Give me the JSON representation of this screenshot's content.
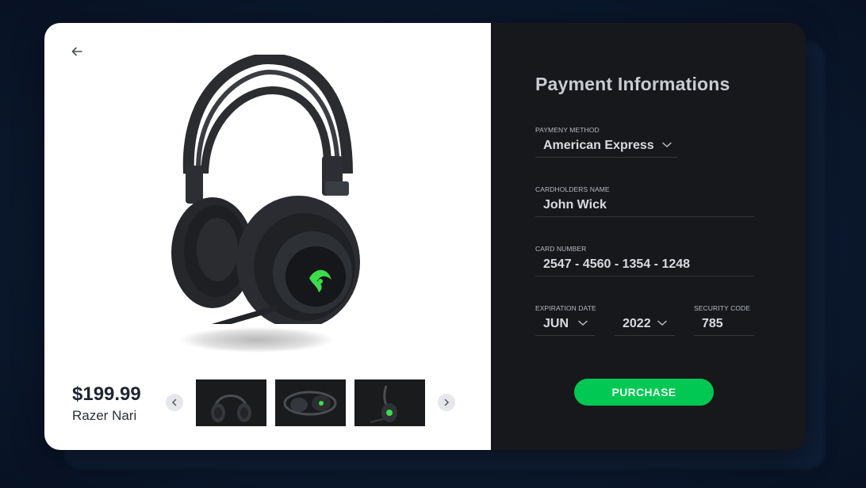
{
  "product": {
    "price": "$199.99",
    "name": "Razer Nari",
    "image_icon": "headset-image",
    "thumbnails": [
      "headset-front-thumbnail",
      "headset-flat-thumbnail",
      "headset-side-thumbnail"
    ]
  },
  "payment": {
    "title": "Payment Informations",
    "method_label": "PAYMENY METHOD",
    "method_value": "American Express",
    "cardholder_label": "CARDHOLDERS NAME",
    "cardholder_value": "John Wick",
    "card_number_label": "CARD NUMBER",
    "card_number_value": "2547 - 4560 - 1354 - 1248",
    "expiration_label": "EXPIRATION DATE",
    "exp_month": "JUN",
    "exp_year": "2022",
    "security_label": "SECURITY CODE",
    "security_value": "785",
    "purchase_label": "PURCHASE"
  },
  "colors": {
    "accent": "#00c853",
    "panel_dark": "#16181b",
    "background": "#0c1a30"
  }
}
